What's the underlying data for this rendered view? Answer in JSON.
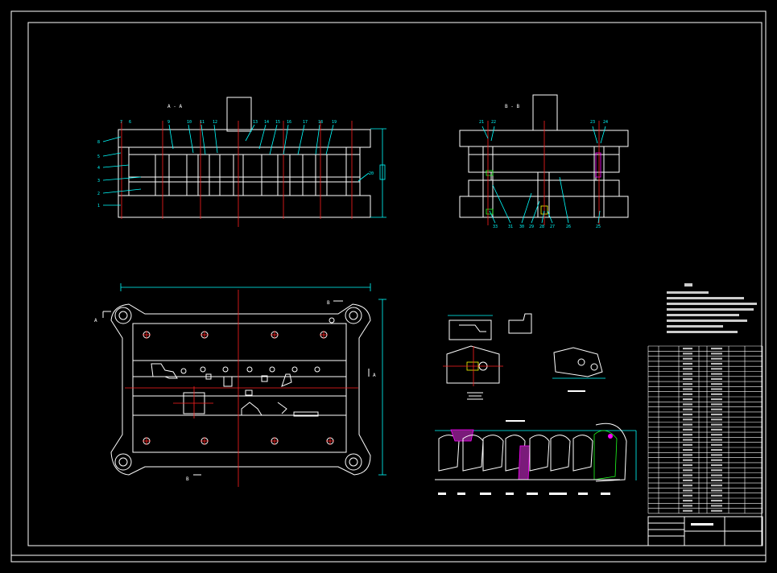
{
  "drawing": {
    "section_aa_label": "A - A",
    "section_bb_label": "B - B",
    "view_marker_a_left": "A",
    "view_marker_a_right": "A",
    "view_marker_b_top": "B",
    "view_marker_b_bottom": "B"
  },
  "section_aa": {
    "left_callouts": [
      "8",
      "5",
      "4",
      "3",
      "2",
      "1"
    ],
    "top_callouts": [
      "7",
      "6",
      "9",
      "10",
      "11",
      "12",
      "13",
      "14",
      "15",
      "16",
      "17",
      "18",
      "19"
    ],
    "right_callout": "20"
  },
  "section_bb": {
    "top_callouts": [
      "21",
      "22",
      "23",
      "24"
    ],
    "bottom_callouts": [
      "33",
      "31",
      "30",
      "29",
      "28",
      "27",
      "26",
      "25"
    ]
  },
  "colors": {
    "background": "#000000",
    "outline": "#ffffff",
    "dimension": "#00ffff",
    "centerline": "#ff2020",
    "hatch": "#ff00ff",
    "accent_yellow": "#ffff00",
    "accent_green": "#20ff20"
  }
}
